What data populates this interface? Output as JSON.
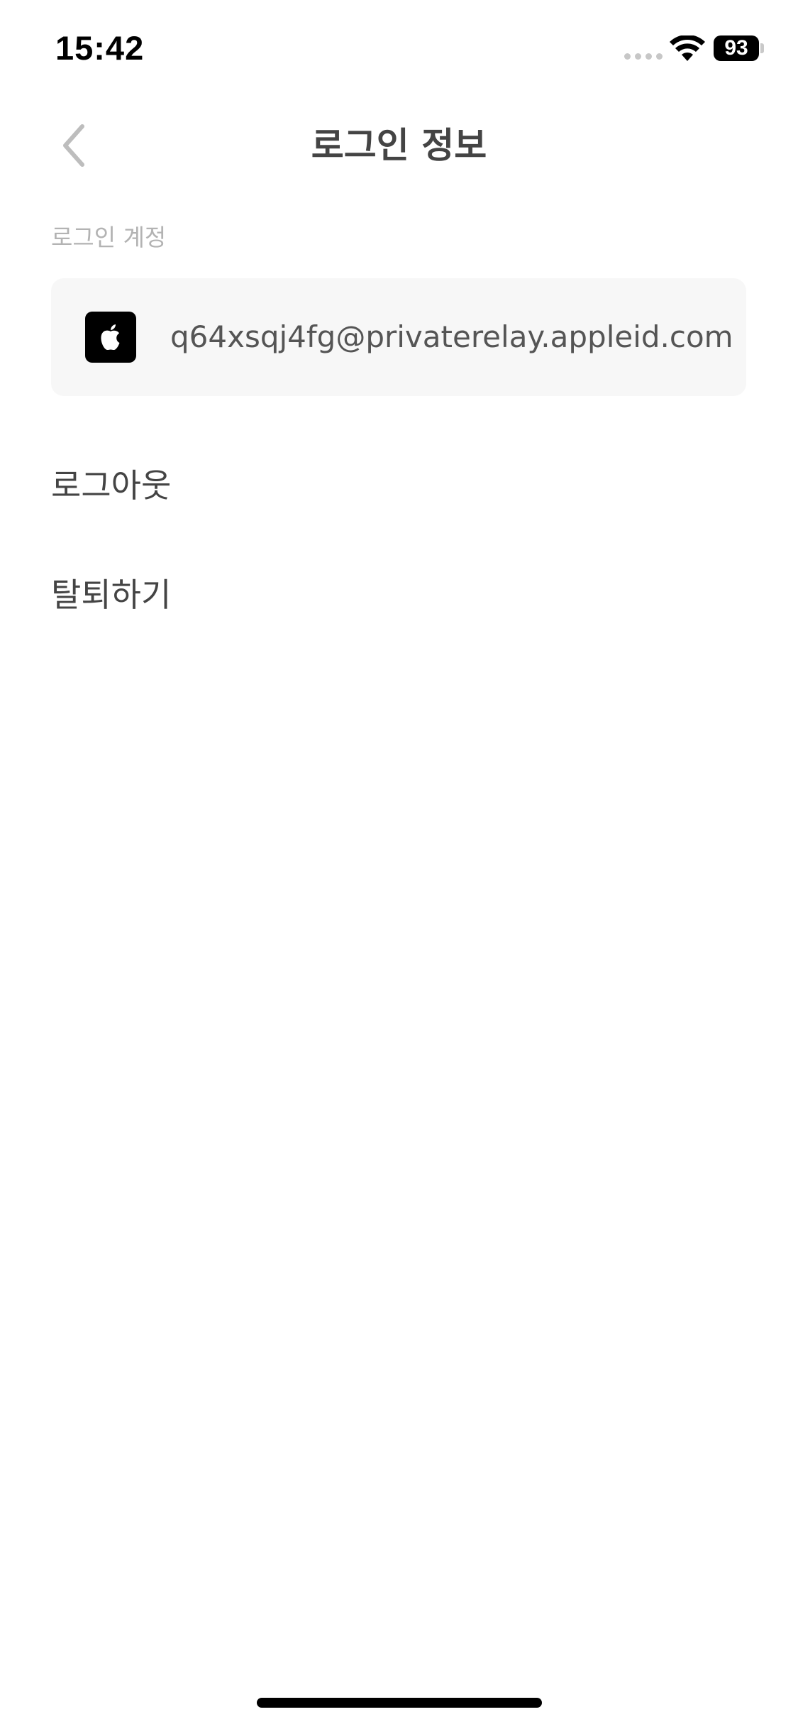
{
  "status_bar": {
    "time": "15:42",
    "battery_level": "93",
    "icons": [
      "signal-dots-icon",
      "wifi-icon",
      "battery-icon"
    ]
  },
  "nav": {
    "back_icon": "chevron-left-icon",
    "title": "로그인 정보"
  },
  "section": {
    "label": "로그인 계정"
  },
  "account": {
    "provider_icon": "apple-icon",
    "email": "q64xsqj4fg@privaterelay.appleid.com"
  },
  "menu": {
    "logout_label": "로그아웃",
    "withdraw_label": "탈퇴하기"
  },
  "colors": {
    "card_background": "#f7f7f7",
    "label_gray": "#b3b3b3",
    "text_dark": "#444444"
  }
}
